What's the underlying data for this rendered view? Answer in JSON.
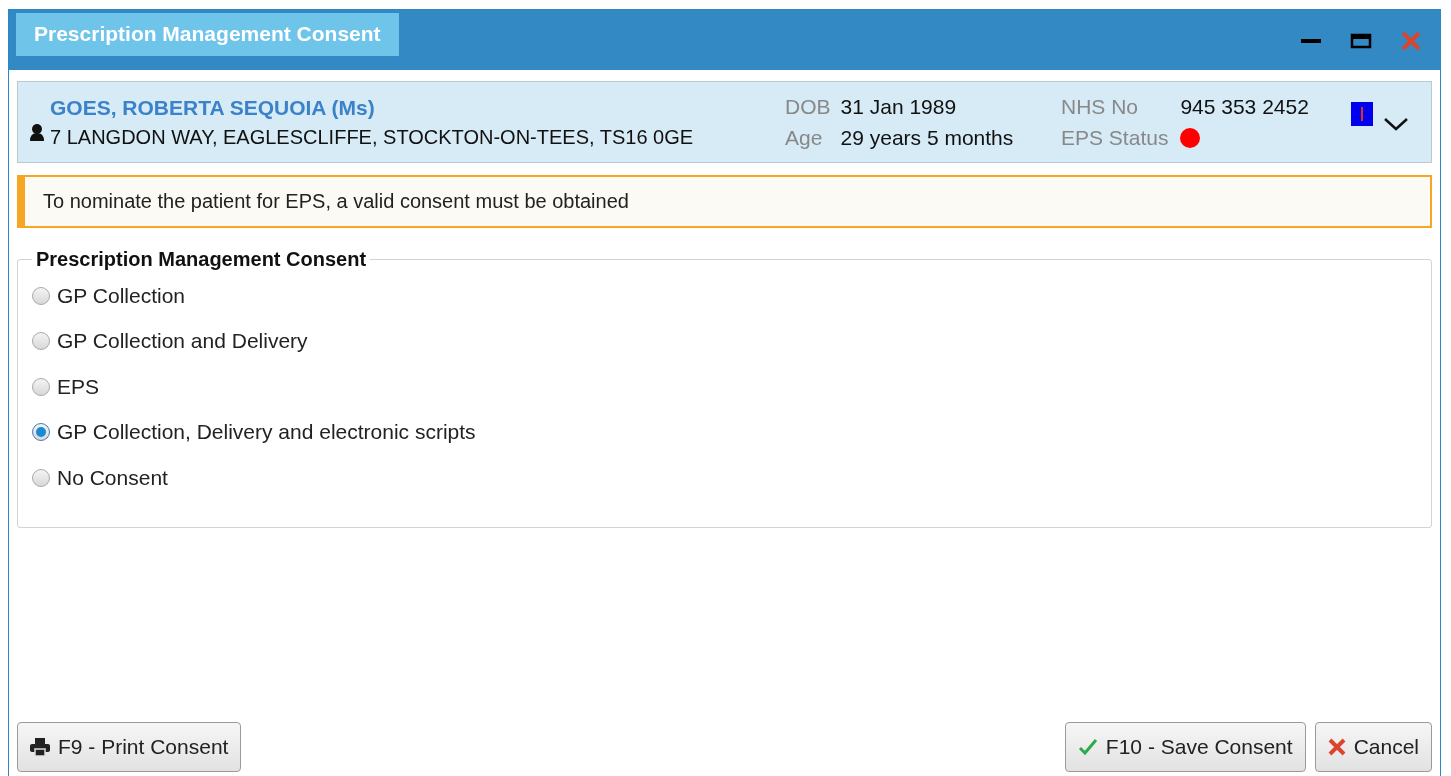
{
  "window": {
    "title": "Prescription Management Consent"
  },
  "patient": {
    "name": "GOES, ROBERTA SEQUOIA (Ms)",
    "address": "7 LANGDON WAY, EAGLESCLIFFE, STOCKTON-ON-TEES, TS16 0GE",
    "dob_label": "DOB",
    "dob": "31 Jan 1989",
    "age_label": "Age",
    "age": "29 years 5 months",
    "nhs_label": "NHS No",
    "nhs": "945 353 2452",
    "eps_status": {
      "label": "EPS Status",
      "color": "#ff0000"
    }
  },
  "notice": "To nominate the patient for EPS, a valid consent must be obtained",
  "consent": {
    "legend": "Prescription Management Consent",
    "options": [
      {
        "label": "GP Collection",
        "selected": false
      },
      {
        "label": "GP Collection and Delivery",
        "selected": false
      },
      {
        "label": "EPS",
        "selected": false
      },
      {
        "label": "GP Collection, Delivery and electronic scripts",
        "selected": true
      },
      {
        "label": "No Consent",
        "selected": false
      }
    ]
  },
  "buttons": [
    {
      "kind": "print",
      "label": "F9 - Print Consent"
    },
    {
      "kind": "save",
      "label": "F10 - Save Consent"
    },
    {
      "kind": "cancel",
      "label": "Cancel"
    }
  ]
}
